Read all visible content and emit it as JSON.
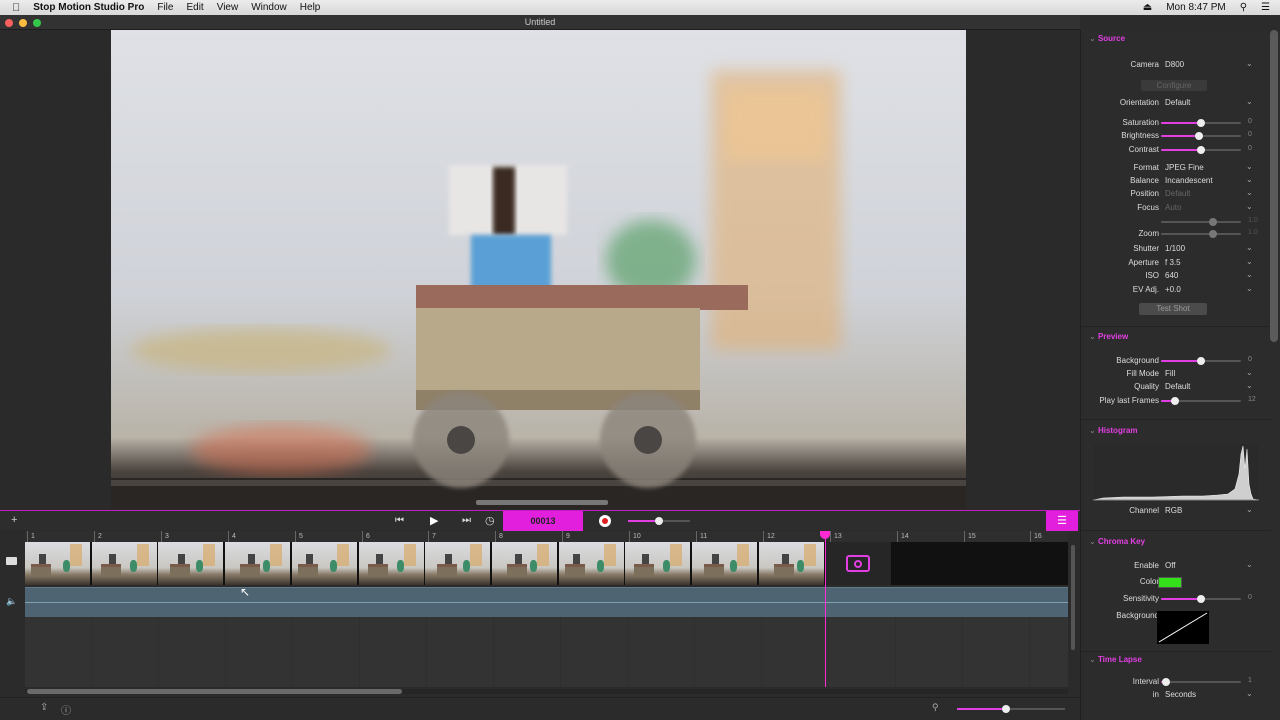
{
  "menubar": {
    "app_name": "Stop Motion Studio Pro",
    "menus": [
      "File",
      "Edit",
      "View",
      "Window",
      "Help"
    ],
    "clock": "Mon 8:47 PM",
    "icons": [
      "apple-icon",
      "eject-icon",
      "search-icon",
      "list-icon"
    ]
  },
  "window": {
    "title": "Untitled"
  },
  "transport": {
    "frame_counter": "00013",
    "buttons": [
      "add-icon",
      "skip-back-icon",
      "play-icon",
      "skip-forward-icon",
      "timer-icon",
      "record-icon",
      "settings-toggle-icon"
    ],
    "speed_slider_value": 0.5
  },
  "timeline": {
    "ruler_labels": [
      "1",
      "2",
      "3",
      "4",
      "5",
      "6",
      "7",
      "8",
      "9",
      "10",
      "11",
      "12",
      "13",
      "14",
      "15",
      "16"
    ],
    "frame_count": 12,
    "current_frame": 13,
    "scroll_fraction": 0.36
  },
  "status": {
    "zoom_fraction": 0.45,
    "icons": [
      "share-icon",
      "info-icon",
      "zoom-icon",
      "camera-icon",
      "play-small-icon",
      "circle-icon",
      "frame-icon",
      "layers-icon",
      "film-icon",
      "export-icon"
    ]
  },
  "panel": {
    "source": {
      "title": "Source",
      "camera_label": "Camera",
      "camera_value": "D800",
      "configure_label": "Configure",
      "orientation_label": "Orientation",
      "orientation_value": "Default",
      "saturation_label": "Saturation",
      "saturation_num": "0",
      "saturation_level": 0.5,
      "brightness_label": "Brightness",
      "brightness_num": "0",
      "brightness_level": 0.48,
      "contrast_label": "Contrast",
      "contrast_num": "0",
      "contrast_level": 0.5,
      "format_label": "Format",
      "format_value": "JPEG Fine",
      "balance_label": "Balance",
      "balance_value": "Incandescent",
      "position_label": "Position",
      "position_value": "Default",
      "focus_label": "Focus",
      "focus_value": "Auto",
      "focus_num": "1.0",
      "zoom_label": "Zoom",
      "zoom_num": "1.0",
      "shutter_label": "Shutter",
      "shutter_value": "1/100",
      "aperture_label": "Aperture",
      "aperture_value": "f 3.5",
      "iso_label": "ISO",
      "iso_value": "640",
      "ev_label": "EV Adj.",
      "ev_value": "+0.0",
      "test_shot_label": "Test Shot"
    },
    "preview": {
      "title": "Preview",
      "background_label": "Background",
      "background_num": "0",
      "background_level": 0.5,
      "fill_mode_label": "Fill Mode",
      "fill_mode_value": "Fill",
      "quality_label": "Quality",
      "quality_value": "Default",
      "play_last_label": "Play last Frames",
      "play_last_num": "12",
      "play_last_level": 0.17
    },
    "histogram": {
      "title": "Histogram",
      "channel_label": "Channel",
      "channel_value": "RGB"
    },
    "chroma": {
      "title": "Chroma Key",
      "enable_label": "Enable",
      "enable_value": "Off",
      "color_label": "Color",
      "color_value": "#33e01a",
      "sensitivity_label": "Sensitivity",
      "sensitivity_num": "0",
      "sensitivity_level": 0.5,
      "background_label": "Background"
    },
    "timelapse": {
      "title": "Time Lapse",
      "interval_label": "Interval",
      "interval_num": "1",
      "interval_level": 0.06,
      "in_label": "in",
      "in_value": "Seconds"
    }
  },
  "colors": {
    "accent": "#e23fe2",
    "playhead": "#ff2ad4",
    "audio": "#4e6472"
  }
}
